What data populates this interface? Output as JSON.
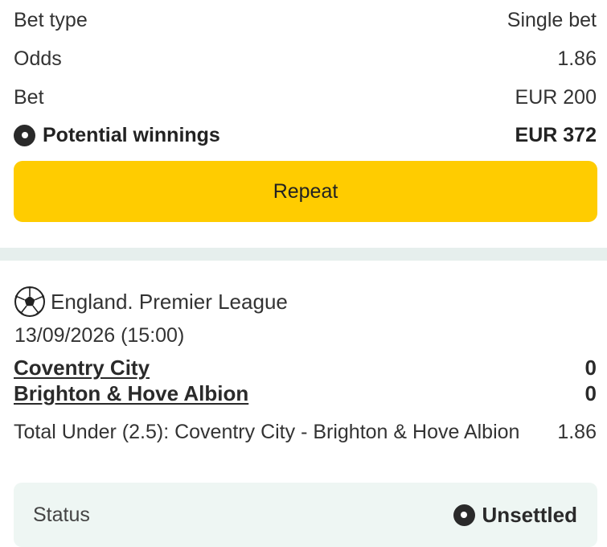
{
  "summary": {
    "bet_type_label": "Bet type",
    "bet_type_value": "Single bet",
    "odds_label": "Odds",
    "odds_value": "1.86",
    "bet_label": "Bet",
    "bet_value": "EUR 200",
    "winnings_label": "Potential winnings",
    "winnings_value": "EUR 372",
    "repeat_label": "Repeat"
  },
  "event": {
    "league": "England. Premier League",
    "datetime": "13/09/2026 (15:00)",
    "home_team": "Coventry City",
    "home_score": "0",
    "away_team": "Brighton & Hove Albion",
    "away_score": "0",
    "market": "Total Under (2.5): Coventry City - Brighton & Hove Albion",
    "market_odds": "1.86",
    "sport_icon": "soccer-ball-icon"
  },
  "status": {
    "label": "Status",
    "value": "Unsettled"
  },
  "colors": {
    "accent": "#ffcc00",
    "divider": "#e6efed",
    "status_bg": "#eef6f3"
  }
}
